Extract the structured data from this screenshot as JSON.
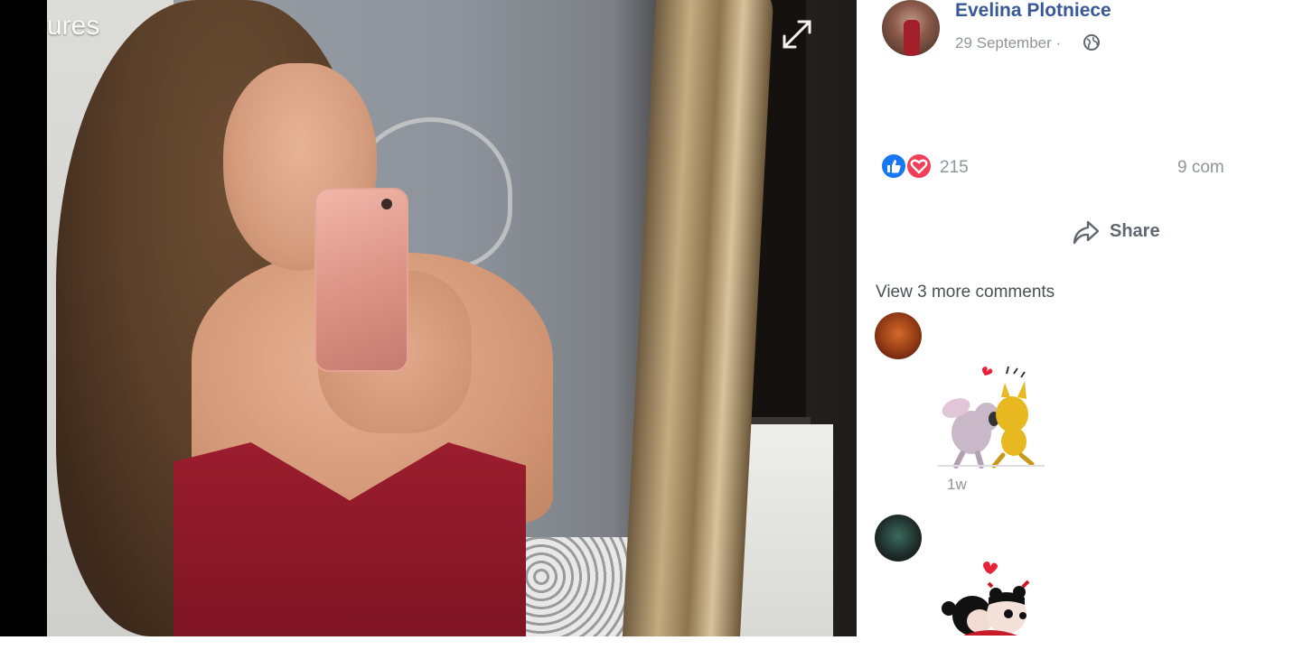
{
  "photo": {
    "caption_fragment": "ures"
  },
  "post": {
    "author_name": "Evelina Plotniece",
    "date": "29 September ·",
    "reaction_count": "215",
    "comments_count": "9 com",
    "share_label": "Share"
  },
  "comments": {
    "view_more": "View 3 more comments",
    "items": [
      {
        "time": "1w",
        "sticker": "kiss-sticker-icon"
      },
      {
        "time": "",
        "sticker": "pucca-kiss-sticker-icon"
      }
    ]
  },
  "colors": {
    "link_blue": "#385898",
    "meta_gray": "#90949c",
    "like_blue": "#1877f2",
    "love_red": "#f33e58"
  }
}
